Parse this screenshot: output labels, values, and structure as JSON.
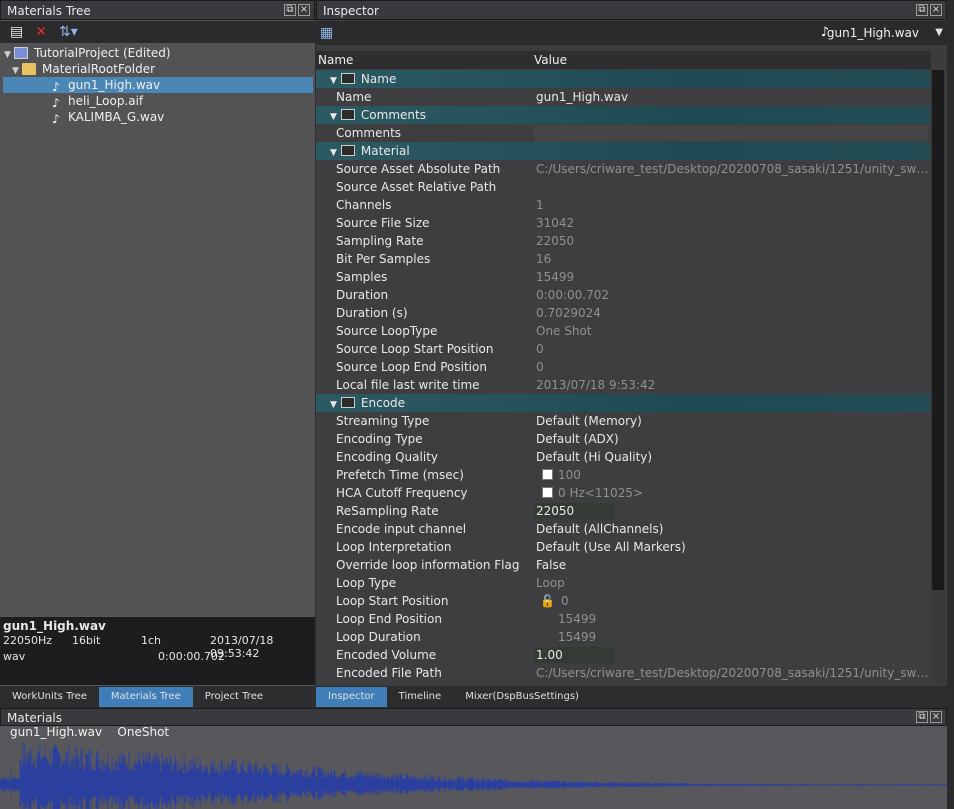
{
  "materials_tree": {
    "title": "Materials Tree",
    "items": [
      {
        "label": "TutorialProject (Edited)"
      },
      {
        "label": "MaterialRootFolder"
      },
      {
        "label": "gun1_High.wav"
      },
      {
        "label": "heli_Loop.aif"
      },
      {
        "label": "KALIMBA_G.wav"
      }
    ],
    "info": {
      "filename": "gun1_High.wav",
      "rate": "22050Hz",
      "bits": "16bit",
      "channels": "1ch",
      "date": "2013/07/18 09:53:42",
      "format": "wav",
      "duration": "0:00:00.702"
    }
  },
  "left_tabs": [
    "WorkUnits Tree",
    "Materials Tree",
    "Project Tree"
  ],
  "inspector": {
    "title": "Inspector",
    "selected_file": "gun1_High.wav",
    "col_name": "Name",
    "col_value": "Value",
    "rows": [
      {
        "type": "group",
        "key": "Name"
      },
      {
        "key": "Name",
        "value": "gun1_High.wav"
      },
      {
        "type": "group",
        "key": "Comments"
      },
      {
        "key": "Comments",
        "value": ""
      },
      {
        "type": "group",
        "key": "Material"
      },
      {
        "key": "Source Asset Absolute Path",
        "value": "C:/Users/criware_test/Desktop/20200708_sasaki/1251/unity_switch_sdk_j...",
        "dim": true
      },
      {
        "key": "Source Asset Relative Path",
        "value": "",
        "dim": true
      },
      {
        "key": "Channels",
        "value": "1",
        "dim": true
      },
      {
        "key": "Source File Size",
        "value": "31042",
        "dim": true
      },
      {
        "key": "Sampling Rate",
        "value": "22050",
        "dim": true
      },
      {
        "key": "Bit Per Samples",
        "value": "16",
        "dim": true
      },
      {
        "key": "Samples",
        "value": "15499",
        "dim": true
      },
      {
        "key": "Duration",
        "value": "0:00:00.702",
        "dim": true
      },
      {
        "key": "Duration (s)",
        "value": "0.7029024",
        "dim": true
      },
      {
        "key": "Source LoopType",
        "value": "One Shot",
        "dim": true
      },
      {
        "key": "Source Loop Start Position",
        "value": "0",
        "dim": true
      },
      {
        "key": "Source Loop End Position",
        "value": "0",
        "dim": true
      },
      {
        "key": "Local file last write time",
        "value": "2013/07/18 9:53:42",
        "dim": true
      },
      {
        "type": "group",
        "key": "Encode"
      },
      {
        "key": "Streaming Type",
        "value": "Default (Memory)"
      },
      {
        "key": "Encoding Type",
        "value": "Default (ADX)"
      },
      {
        "key": "Encoding Quality",
        "value": "Default (Hi Quality)"
      },
      {
        "key": "Prefetch Time (msec)",
        "value": "100",
        "dim": true,
        "checkbox": true
      },
      {
        "key": "HCA Cutoff Frequency",
        "value": "0 Hz<11025>",
        "dim": true,
        "checkbox": true
      },
      {
        "key": "ReSampling Rate",
        "value": "22050",
        "box": true
      },
      {
        "key": "Encode input channel",
        "value": "Default (AllChannels)"
      },
      {
        "key": "Loop Interpretation",
        "value": "Default (Use All Markers)"
      },
      {
        "key": "Override loop information Flag",
        "value": "False"
      },
      {
        "key": "Loop Type",
        "value": "Loop",
        "dim": true
      },
      {
        "key": "Loop Start Position",
        "value": "0",
        "dim": true,
        "lock": true
      },
      {
        "key": "Loop End Position",
        "value": "15499",
        "dim": true,
        "indent": true
      },
      {
        "key": "Loop Duration",
        "value": "15499",
        "dim": true,
        "indent": true
      },
      {
        "key": "Encoded Volume",
        "value": "1.00",
        "box": true
      },
      {
        "key": "Encoded File Path",
        "value": "C:/Users/criware_test/Desktop/20200708_sasaki/1251/unity_switch_sdk_j...",
        "dim": true
      }
    ]
  },
  "inspector_tabs": [
    "Inspector",
    "Timeline",
    "Mixer(DspBusSettings)"
  ],
  "materials_panel": {
    "title": "Materials",
    "wave_name": "gun1_High.wav",
    "wave_type": "OneShot"
  },
  "colors": {
    "selection": "#4a86b6",
    "group_header": "#2c5a63",
    "waveform": "#2b3f9e"
  }
}
